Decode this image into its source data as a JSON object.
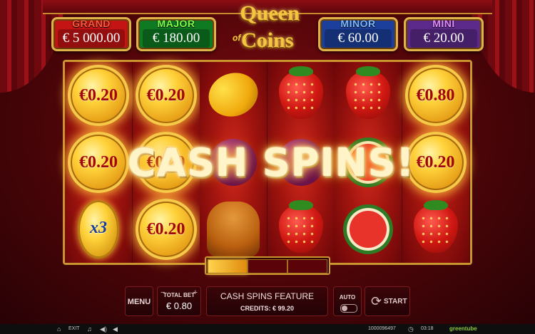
{
  "jackpots": [
    {
      "label": "GRAND",
      "value": "€ 5 000.00",
      "bg": "#c41414",
      "label_color": "#ff5a3a"
    },
    {
      "label": "MAJOR",
      "value": "€ 180.00",
      "bg": "#0e7a22",
      "label_color": "#7fff4a"
    },
    {
      "label": "MINOR",
      "value": "€ 60.00",
      "bg": "#1c3f9c",
      "label_color": "#7ab8ff"
    },
    {
      "label": "MINI",
      "value": "€ 20.00",
      "bg": "#5c2a8a",
      "label_color": "#e28aff"
    }
  ],
  "logo": {
    "line1": "Queen",
    "line2": "of",
    "line3": "Coins"
  },
  "reels": [
    [
      {
        "type": "coin",
        "text": "€0.20"
      },
      {
        "type": "coin",
        "text": "€0.20"
      },
      {
        "type": "multiplier",
        "text": "x3"
      }
    ],
    [
      {
        "type": "coin",
        "text": "€0.20"
      },
      {
        "type": "coin",
        "text": "€0.20"
      },
      {
        "type": "coin",
        "text": "€0.20"
      }
    ],
    [
      {
        "type": "lemon"
      },
      {
        "type": "plum"
      },
      {
        "type": "jester"
      }
    ],
    [
      {
        "type": "strawberry"
      },
      {
        "type": "plum"
      },
      {
        "type": "strawberry"
      }
    ],
    [
      {
        "type": "strawberry"
      },
      {
        "type": "watermelon"
      },
      {
        "type": "watermelon"
      }
    ],
    [
      {
        "type": "coin",
        "text": "€0.80"
      },
      {
        "type": "coin",
        "text": "€0.20"
      },
      {
        "type": "strawberry"
      }
    ]
  ],
  "overlay_text": "CASH SPINS!",
  "controls": {
    "menu": "MENU",
    "bet_minus": "−",
    "bet_plus": "+",
    "total_bet_label": "TOTAL BET",
    "total_bet_value": "€ 0.80",
    "feature_title": "CASH SPINS FEATURE",
    "credits": "CREDITS: € 99.20",
    "auto": "AUTO",
    "start": "START"
  },
  "bottom_bar": {
    "exit": "EXIT",
    "session_id": "1000096497",
    "time": "03:18",
    "brand": "greentube"
  }
}
